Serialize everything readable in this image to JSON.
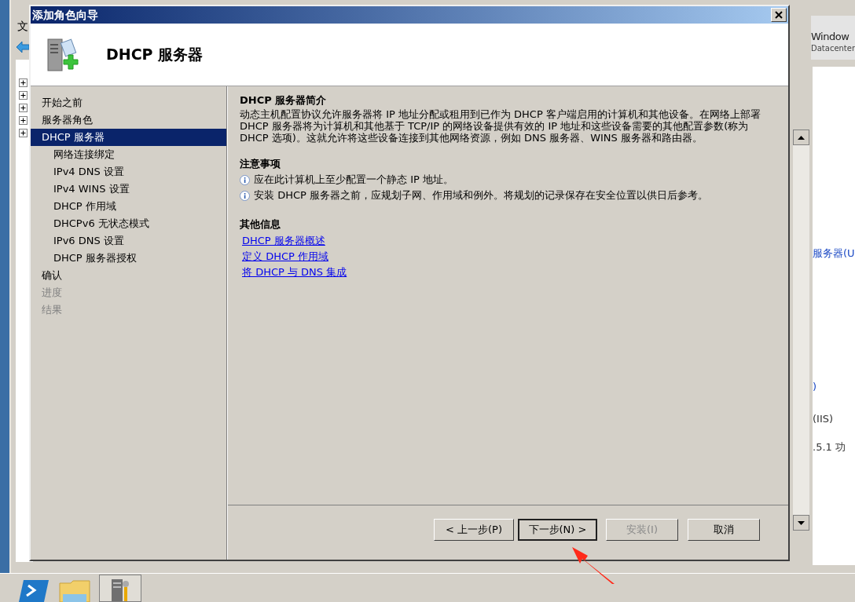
{
  "background_window": {
    "menu_item": "文",
    "brand": {
      "name": "Window",
      "edition": "Datacenter"
    },
    "tree": [
      {
        "expanded": false
      },
      {
        "expanded": false
      },
      {
        "expanded": false
      },
      {
        "expanded": false
      },
      {
        "expanded": false
      }
    ],
    "right_pane_texts": [
      "服务器(U",
      ")",
      "(IIS)",
      ".5.1 功"
    ]
  },
  "dialog": {
    "title": "添加角色向导",
    "header": "DHCP 服务器",
    "steps": [
      {
        "label": "开始之前",
        "selected": false,
        "disabled": false
      },
      {
        "label": "服务器角色",
        "selected": false,
        "disabled": false
      },
      {
        "label": "DHCP 服务器",
        "selected": true,
        "disabled": false,
        "children": [
          {
            "label": "网络连接绑定",
            "selected": false,
            "disabled": false
          },
          {
            "label": "IPv4 DNS 设置",
            "selected": false,
            "disabled": false
          },
          {
            "label": "IPv4 WINS 设置",
            "selected": false,
            "disabled": false
          },
          {
            "label": "DHCP 作用域",
            "selected": false,
            "disabled": false
          },
          {
            "label": "DHCPv6 无状态模式",
            "selected": false,
            "disabled": false
          },
          {
            "label": "IPv6 DNS 设置",
            "selected": false,
            "disabled": false
          },
          {
            "label": "DHCP 服务器授权",
            "selected": false,
            "disabled": false
          }
        ]
      },
      {
        "label": "确认",
        "selected": false,
        "disabled": false
      },
      {
        "label": "进度",
        "selected": false,
        "disabled": true
      },
      {
        "label": "结果",
        "selected": false,
        "disabled": true
      }
    ],
    "intro": {
      "title": "DHCP 服务器简介",
      "text": "动态主机配置协议允许服务器将 IP 地址分配或租用到已作为 DHCP 客户端启用的计算机和其他设备。在网络上部署 DHCP 服务器将为计算机和其他基于 TCP/IP 的网络设备提供有效的 IP 地址和这些设备需要的其他配置参数(称为 DHCP 选项)。这就允许将这些设备连接到其他网络资源，例如 DNS 服务器、WINS 服务器和路由器。"
    },
    "notes": {
      "title": "注意事项",
      "items": [
        "应在此计算机上至少配置一个静态 IP 地址。",
        "安装 DHCP 服务器之前，应规划子网、作用域和例外。将规划的记录保存在安全位置以供日后参考。"
      ]
    },
    "more_info": {
      "title": "其他信息",
      "links": [
        "DHCP 服务器概述",
        "定义 DHCP 作用域",
        "将 DHCP 与 DNS 集成"
      ]
    },
    "buttons": [
      {
        "label": "< 上一步(P)",
        "disabled": false,
        "default": false
      },
      {
        "label": "下一步(N) >",
        "disabled": false,
        "default": true
      },
      {
        "label": "安装(I)",
        "disabled": true,
        "default": false
      },
      {
        "label": "取消",
        "disabled": false,
        "default": false
      }
    ]
  }
}
